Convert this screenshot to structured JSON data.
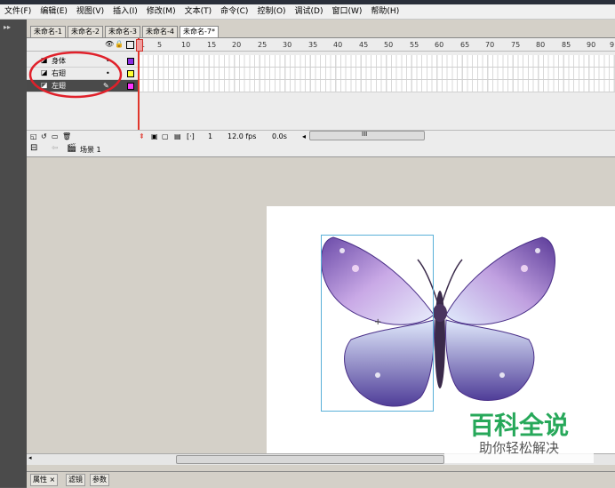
{
  "menubar": {
    "items": [
      "文件(F)",
      "编辑(E)",
      "视图(V)",
      "插入(I)",
      "修改(M)",
      "文本(T)",
      "命令(C)",
      "控制(O)",
      "调试(D)",
      "窗口(W)",
      "帮助(H)"
    ]
  },
  "document_tabs": [
    "未命名-1",
    "未命名-2",
    "未命名-3",
    "未命名-4",
    "未命名-7*"
  ],
  "timeline": {
    "frame_ticks": [
      "1",
      "5",
      "10",
      "15",
      "20",
      "25",
      "30",
      "35",
      "40",
      "45",
      "50",
      "55",
      "60",
      "65",
      "70",
      "75",
      "80",
      "85",
      "90",
      "9"
    ],
    "layers": [
      {
        "name": "身体",
        "color": "#8a2be2",
        "selected": false
      },
      {
        "name": "右翅",
        "color": "#ffff33",
        "selected": false
      },
      {
        "name": "左翅",
        "color": "#ff33ff",
        "selected": true
      }
    ],
    "current_frame": "1",
    "fps": "12.0 fps",
    "time": "0.0s",
    "scroll_label": "III"
  },
  "editbar": {
    "scene": "场景 1"
  },
  "properties_tabs": [
    "属性 ×",
    "滤镜",
    "参数"
  ],
  "watermark": {
    "title": "百科全说",
    "subtitle": "助你轻松解决"
  },
  "colors": {
    "annotation_red": "#e0202a",
    "selection_box": "#5ab0d8",
    "playhead": "#e0362c"
  }
}
